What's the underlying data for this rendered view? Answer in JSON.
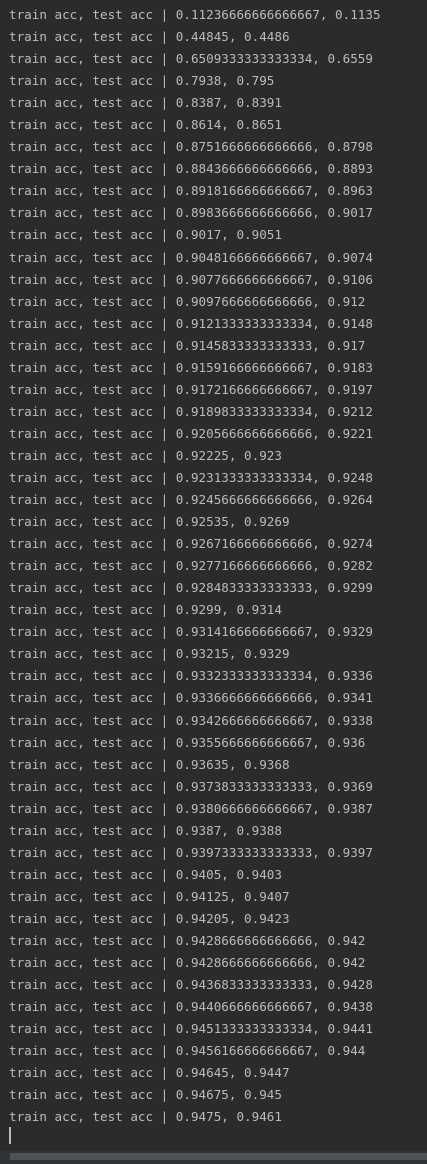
{
  "console": {
    "lines": [
      "train acc, test acc | 0.11236666666666667, 0.1135",
      "train acc, test acc | 0.44845, 0.4486",
      "train acc, test acc | 0.6509333333333334, 0.6559",
      "train acc, test acc | 0.7938, 0.795",
      "train acc, test acc | 0.8387, 0.8391",
      "train acc, test acc | 0.8614, 0.8651",
      "train acc, test acc | 0.8751666666666666, 0.8798",
      "train acc, test acc | 0.8843666666666666, 0.8893",
      "train acc, test acc | 0.8918166666666667, 0.8963",
      "train acc, test acc | 0.8983666666666666, 0.9017",
      "train acc, test acc | 0.9017, 0.9051",
      "train acc, test acc | 0.9048166666666667, 0.9074",
      "train acc, test acc | 0.9077666666666667, 0.9106",
      "train acc, test acc | 0.9097666666666666, 0.912",
      "train acc, test acc | 0.9121333333333334, 0.9148",
      "train acc, test acc | 0.9145833333333333, 0.917",
      "train acc, test acc | 0.9159166666666667, 0.9183",
      "train acc, test acc | 0.9172166666666667, 0.9197",
      "train acc, test acc | 0.9189833333333334, 0.9212",
      "train acc, test acc | 0.9205666666666666, 0.9221",
      "train acc, test acc | 0.92225, 0.923",
      "train acc, test acc | 0.9231333333333334, 0.9248",
      "train acc, test acc | 0.9245666666666666, 0.9264",
      "train acc, test acc | 0.92535, 0.9269",
      "train acc, test acc | 0.9267166666666666, 0.9274",
      "train acc, test acc | 0.9277166666666666, 0.9282",
      "train acc, test acc | 0.9284833333333333, 0.9299",
      "train acc, test acc | 0.9299, 0.9314",
      "train acc, test acc | 0.9314166666666667, 0.9329",
      "train acc, test acc | 0.93215, 0.9329",
      "train acc, test acc | 0.9332333333333334, 0.9336",
      "train acc, test acc | 0.9336666666666666, 0.9341",
      "train acc, test acc | 0.9342666666666667, 0.9338",
      "train acc, test acc | 0.9355666666666667, 0.936",
      "train acc, test acc | 0.93635, 0.9368",
      "train acc, test acc | 0.9373833333333333, 0.9369",
      "train acc, test acc | 0.9380666666666667, 0.9387",
      "train acc, test acc | 0.9387, 0.9388",
      "train acc, test acc | 0.9397333333333333, 0.9397",
      "train acc, test acc | 0.9405, 0.9403",
      "train acc, test acc | 0.94125, 0.9407",
      "train acc, test acc | 0.94205, 0.9423",
      "train acc, test acc | 0.9428666666666666, 0.942",
      "train acc, test acc | 0.9428666666666666, 0.942",
      "train acc, test acc | 0.9436833333333333, 0.9428",
      "train acc, test acc | 0.9440666666666667, 0.9438",
      "train acc, test acc | 0.9451333333333334, 0.9441",
      "train acc, test acc | 0.9456166666666667, 0.944",
      "train acc, test acc | 0.94645, 0.9447",
      "train acc, test acc | 0.94675, 0.945",
      "train acc, test acc | 0.9475, 0.9461"
    ]
  },
  "colors": {
    "background": "#2b2b2b",
    "text": "#bbbbbb",
    "scrollbar_track": "#313335",
    "scrollbar_thumb": "#4f5254"
  }
}
